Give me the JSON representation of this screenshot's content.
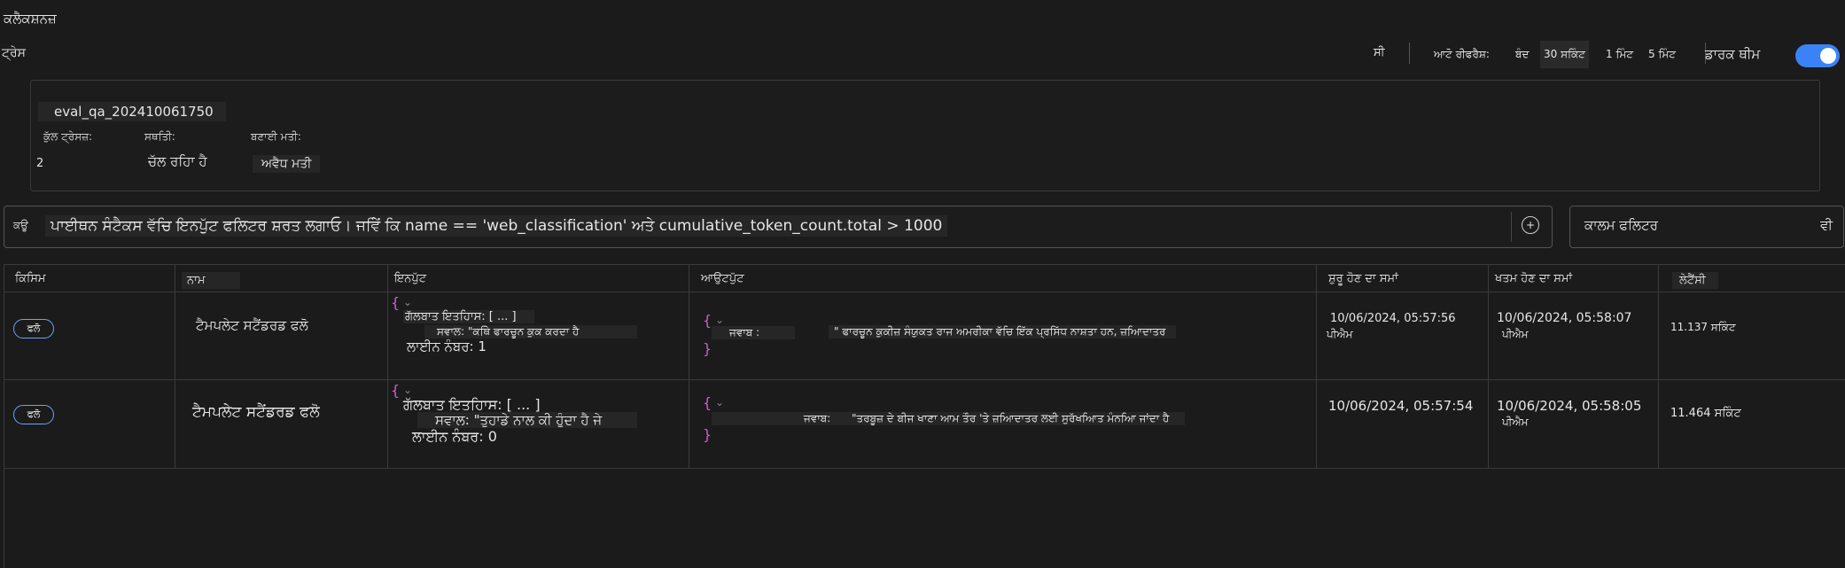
{
  "app": {
    "title": "ਕਲੈਕਸ਼ਨਜ਼",
    "tab": "ਟ੍ਰੇਸ"
  },
  "toolbar": {
    "reset_label": "ਸੀ",
    "auto_refresh_label": "ਆਟੋ ਰੀਫਰੈਸ਼:",
    "refresh_options": [
      "ਬੰਦ",
      "30 ਸਕਿੰਟ",
      "1 ਮਿੰਟ",
      "5 ਮਿੰਟ"
    ],
    "dark_theme_label": "ਡਾਰਕ ਥੀਮ",
    "dark_theme_on": true,
    "accent_color": "#3b82f6"
  },
  "run": {
    "name": "eval_qa_202410061750",
    "total_traces_label": "ਕੁੱਲ ਟ੍ਰੇਸਜ਼:",
    "total_traces_value": "2",
    "status_label": "ਸਥਤਿੀ:",
    "status_value": "ਚੱਲ ਰਹਿਾ ਹੈ",
    "created_label": "ਬਣਾਈ ਮਤੀ:",
    "created_value": "ਅਵੈਧ ਮਤੀ"
  },
  "query": {
    "prefix": "ਕਊ",
    "text": "ਪਾਈਥਨ ਸੰਟੈਕਸ ਵੱਚਿ ਇਨਪੁੱਟ ਫਲਿਟਰ ਸ਼ਰਤ ਲਗਾਓ। ਜਵਿੇਂ ਕਿ name == 'web_classification' ਅਤੇ cumulative_token_count.total > 1000",
    "column_filter_label": "ਕਾਲਮ ਫਲਿਟਰ",
    "column_filter_suffix": "ਵੀ"
  },
  "table": {
    "columns": [
      "ਕਿਸਿਮ",
      "ਨਾਮ",
      "ਇਨਪੁੱਟ",
      "ਆਉਟਪੁੱਟ",
      "ਸ਼ੁਰੂ ਹੋਣ ਦਾ ਸਮਾਂ",
      "ਖਤਮ ਹੋਣ ਦਾ ਸਮਾਂ",
      "ਲੇਟੈਂਸੀ"
    ],
    "rows": [
      {
        "kind": "ਫਲੋ",
        "name": "ਟੈਮਪਲੇਟ ਸਟੈਂਡਰਡ ਫਲੋ",
        "input_brace": "{",
        "input_history": "ਗੱਲਬਾਤ ਇਤਹਿਾਸ: [ ... ]",
        "input_question": "ਸਵਾਲ: \"ਕਥਿੇ ਫਾਰਚੂਨ ਕੁਕ ਕਰਦਾ ਹੈ",
        "input_line": "ਲਾਈਨ ਨੰਬਰ: 1",
        "output_brace_open": "{",
        "output_key": "ਜਵਾਬ :",
        "output_text": "\" ਫਾਰਚੂਨ ਕੁਕੀਜ਼ ਸੰਯੁਕਤ ਰਾਜ ਅਮਰੀਕਾ ਵੱਚਿ ਇੱਕ ਪ੍ਰਸਿੱਧ ਨਾਸ਼ਤਾ ਹਨ, ਜ਼ਆਿਦਾਤਰ",
        "output_brace_close": "}",
        "start_date": "10/06/2024, 05:57:56",
        "start_ampm": "ਪੀਐਮ",
        "end_date": "10/06/2024, 05:58:07",
        "end_ampm": "ਪੀਐਮ",
        "latency": "11.137 ਸਕਿੰਟ"
      },
      {
        "kind": "ਫਲੋ",
        "name": "ਟੈਮਪਲੇਟ ਸਟੈਂਡਰਡ ਫਲੋ",
        "input_brace": "{",
        "input_history": "ਗੱਲਬਾਤ ਇਤਹਿਾਸ: [ ... ]",
        "input_question": "ਸਵਾਲ: \"ਤੁਹਾਡੇ ਨਾਲ ਕੀ ਹੁੰਦਾ ਹੈ ਜੇ",
        "input_line": "ਲਾਈਨ ਨੰਬਰ: 0",
        "output_brace_open": "{",
        "output_key": "ਜਵਾਬ:",
        "output_text": "\"ਤਰਬੂਜ਼ ਦੇ ਬੀਜ ਖਾਣਾ ਆਮ ਤੌਰ 'ਤੇ ਜ਼ਆਿਦਾਤਰ ਲਈ ਸੁਰੱਖਆਿਤ ਮੰਨਆਿ ਜਾਂਦਾ ਹੈ",
        "output_brace_close": "}",
        "start_date": "10/06/2024, 05:57:54",
        "start_ampm": "",
        "end_date": "10/06/2024, 05:58:05",
        "end_ampm": "ਪੀਐਮ",
        "latency": "11.464 ਸਕਿੰਟ"
      }
    ]
  }
}
